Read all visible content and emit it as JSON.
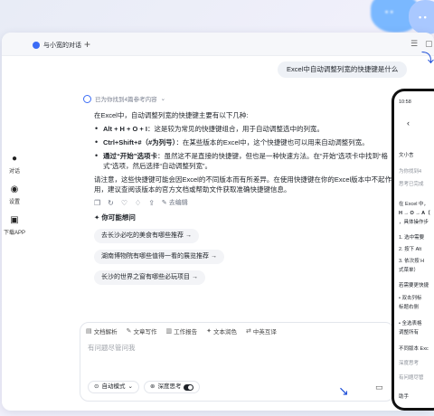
{
  "tab": {
    "label": "与小宽的对话"
  },
  "sidebar": [
    {
      "label": "对话",
      "icon": "chat-icon"
    },
    {
      "label": "设置",
      "icon": "settings-icon"
    },
    {
      "label": "下载APP",
      "icon": "download-icon"
    }
  ],
  "user_message": "Excel中自动调整列宽的快捷键是什么",
  "answer": {
    "refs": "已为你找到4篇参考内容",
    "intro": "在Excel中，自动调整列宽的快捷键主要有以下几种:",
    "bullets": [
      {
        "bold": "Alt + H + O + I",
        "text": "：这是较为常见的快捷键组合，用于自动调整选中的列宽。"
      },
      {
        "bold": "Ctrl+Shift+#（#为列号）",
        "text": "：在某些版本的Excel中，这个快捷键也可以用来自动调整列宽。"
      },
      {
        "bold": "通过“开始”选项卡",
        "text": "：虽然这不是直接的快捷键，但也是一种快速方法。在“开始”选项卡中找到“格式”选项，然后选择“自动调整列宽”。"
      }
    ],
    "note": "请注意，这些快捷键可能会因Excel的不同版本而有所差异。在使用快捷键在你的Excel版本中不起作用，建议查阅该版本的官方文档或帮助文件获取准确快捷键信息。",
    "edit_label": "去编辑",
    "suggest_head": "✦ 你可能想问",
    "suggestions": [
      "去长沙必吃的美食有哪些推荐 →",
      "湖南博物院有哪些值得一看的展览推荐 →",
      "长沙的世界之窗有哪些必玩项目 →"
    ]
  },
  "input": {
    "tools": [
      "文档解析",
      "文章写作",
      "工作报告",
      "文本润色",
      "中英互译"
    ],
    "placeholder": "有问题尽管问我",
    "mode": "自动模式",
    "deep_think": "深度思考"
  },
  "phone": {
    "time": "10:58",
    "title": "文小言",
    "lines": [
      "为你找到4",
      "思考已完成",
      "在 Excel 中，",
      "H → O → A（",
      "，具体操作步",
      "1. 选中需要",
      "2. 按下 Alt",
      "3. 依次按 H",
      "   式菜单）",
      "若需要更快捷",
      "• 双击列标",
      "  标题右侧",
      "• 全选表格",
      "  调整所有",
      "不同版本 Exc",
      "深度思考",
      "有问题尽管",
      "助手"
    ]
  },
  "colors": {
    "accent": "#3b6cf6",
    "arrow": "#1d4ed8"
  }
}
